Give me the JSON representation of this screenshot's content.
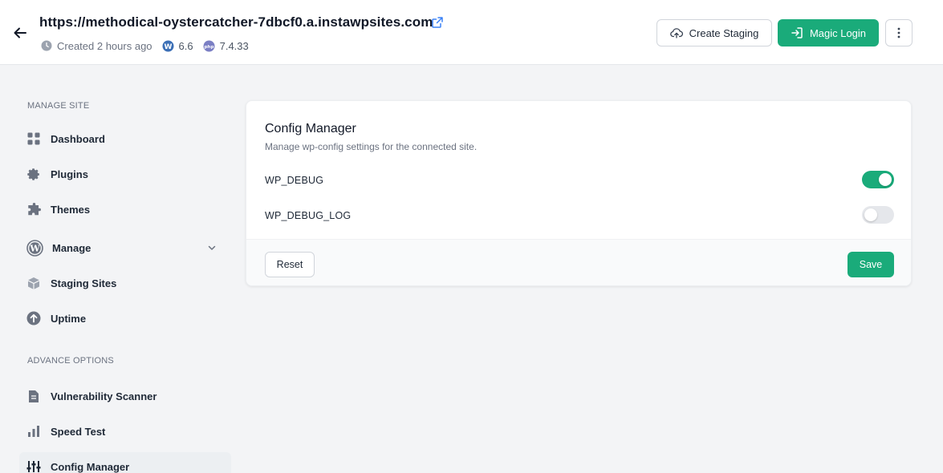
{
  "header": {
    "url": "https://methodical-oystercatcher-7dbcf0.a.instawpsites.com",
    "created": "Created 2 hours ago",
    "wp_version": "6.6",
    "php_version": "7.4.33",
    "create_staging_label": "Create Staging",
    "magic_login_label": "Magic Login"
  },
  "sidebar": {
    "manage_section": "MANAGE SITE",
    "manage_items": [
      {
        "label": "Dashboard",
        "icon": "grid-icon"
      },
      {
        "label": "Plugins",
        "icon": "gear-icon"
      },
      {
        "label": "Themes",
        "icon": "puzzle-icon"
      },
      {
        "label": "Manage",
        "icon": "wordpress-icon"
      },
      {
        "label": "Staging Sites",
        "icon": "cube-icon"
      },
      {
        "label": "Uptime",
        "icon": "arrow-up-circle-icon"
      }
    ],
    "advance_section": "ADVANCE OPTIONS",
    "advance_items": [
      {
        "label": "Vulnerability Scanner",
        "icon": "document-icon"
      },
      {
        "label": "Speed Test",
        "icon": "bar-chart-icon"
      },
      {
        "label": "Config Manager",
        "icon": "sliders-icon",
        "active": true
      }
    ]
  },
  "config": {
    "title": "Config Manager",
    "subtitle": "Manage wp-config settings for the connected site.",
    "settings": [
      {
        "key": "WP_DEBUG",
        "enabled": true
      },
      {
        "key": "WP_DEBUG_LOG",
        "enabled": false
      }
    ],
    "reset_label": "Reset",
    "save_label": "Save"
  },
  "colors": {
    "accent": "#1aab7a",
    "toggle_off": "#e5e7eb"
  }
}
